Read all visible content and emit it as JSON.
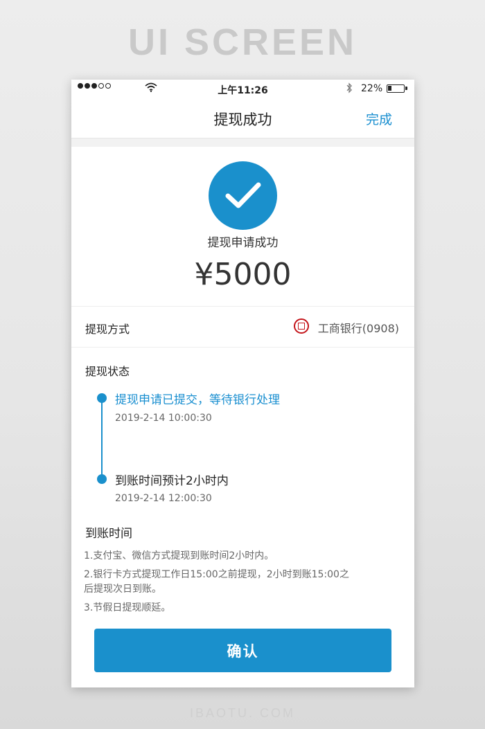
{
  "page": {
    "bg_title": "UI SCREEN",
    "footer": "IBAOTU. COM"
  },
  "status_bar": {
    "time": "上午11:26",
    "battery_pct": "22%",
    "battery_level": 0.22,
    "signal_bars": 5,
    "signal_filled": 3
  },
  "nav": {
    "title": "提现成功",
    "done": "完成"
  },
  "result": {
    "icon": "checkmark-circle-icon",
    "message": "提现申请成功",
    "amount": "¥5000"
  },
  "method": {
    "label": "提现方式",
    "bank_icon": "icbc-bank-icon",
    "bank_name": "工商银行(0908)"
  },
  "status": {
    "title": "提现状态",
    "steps": [
      {
        "text": "提现申请已提交，等待银行处理",
        "time": "2019-2-14 10:00:30",
        "active": true
      },
      {
        "text": "到账时间预计2小时内",
        "time": "2019-2-14 12:00:30",
        "active": false
      }
    ]
  },
  "arrival": {
    "title": "到账时间",
    "rules": [
      "1.支付宝、微信方式提现到账时间2小时内。",
      "2.银行卡方式提现工作日15:00之前提现，2小时到账15:00之后提现次日到账。",
      "3.节假日提现顺延。"
    ]
  },
  "confirm": {
    "label": "确认"
  },
  "colors": {
    "accent": "#1a90cc",
    "bank_red": "#c4141a"
  }
}
